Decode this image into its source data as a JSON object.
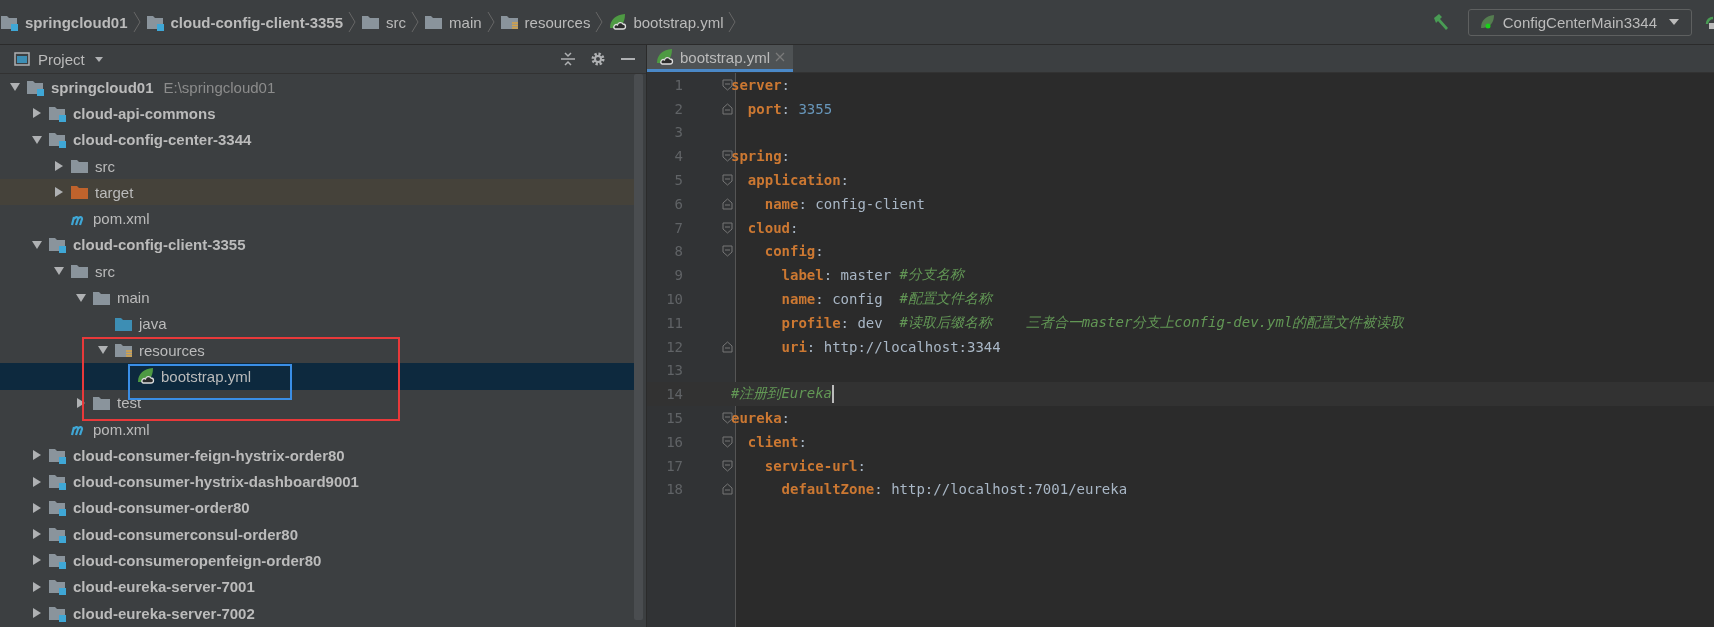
{
  "breadcrumbs": [
    {
      "label": "springcloud01",
      "kind": "module"
    },
    {
      "label": "cloud-config-client-3355",
      "kind": "module"
    },
    {
      "label": "src",
      "kind": "folder"
    },
    {
      "label": "main",
      "kind": "folder"
    },
    {
      "label": "resources",
      "kind": "resources"
    },
    {
      "label": "bootstrap.yml",
      "kind": "yml"
    }
  ],
  "run_config": {
    "label": "ConfigCenterMain3344"
  },
  "project_panel": {
    "title": "Project",
    "tree": [
      {
        "label": "springcloud01",
        "path": "E:\\springcloud01",
        "kind": "module",
        "expanded": true,
        "selected": false,
        "children": [
          {
            "label": "cloud-api-commons",
            "kind": "module",
            "expanded": false,
            "selected": false
          },
          {
            "label": "cloud-config-center-3344",
            "kind": "module",
            "expanded": true,
            "selected": false,
            "children": [
              {
                "label": "src",
                "kind": "folder",
                "expanded": false,
                "selected": false
              },
              {
                "label": "target",
                "kind": "excluded",
                "expanded": false,
                "selected": false
              },
              {
                "label": "pom.xml",
                "kind": "maven",
                "selected": false
              }
            ]
          },
          {
            "label": "cloud-config-client-3355",
            "kind": "module",
            "expanded": true,
            "selected": false,
            "children": [
              {
                "label": "src",
                "kind": "folder",
                "expanded": true,
                "selected": false,
                "children": [
                  {
                    "label": "main",
                    "kind": "folder",
                    "expanded": true,
                    "selected": false,
                    "children": [
                      {
                        "label": "java",
                        "kind": "source",
                        "selected": false
                      },
                      {
                        "label": "resources",
                        "kind": "resources",
                        "expanded": true,
                        "selected": false,
                        "children": [
                          {
                            "label": "bootstrap.yml",
                            "kind": "yml",
                            "selected": true
                          }
                        ]
                      }
                    ]
                  },
                  {
                    "label": "test",
                    "kind": "folder",
                    "expanded": false,
                    "selected": false
                  }
                ]
              },
              {
                "label": "pom.xml",
                "kind": "maven",
                "selected": false
              }
            ]
          },
          {
            "label": "cloud-consumer-feign-hystrix-order80",
            "kind": "module",
            "expanded": false,
            "selected": false
          },
          {
            "label": "cloud-consumer-hystrix-dashboard9001",
            "kind": "module",
            "expanded": false,
            "selected": false
          },
          {
            "label": "cloud-consumer-order80",
            "kind": "module",
            "expanded": false,
            "selected": false
          },
          {
            "label": "cloud-consumerconsul-order80",
            "kind": "module",
            "expanded": false,
            "selected": false
          },
          {
            "label": "cloud-consumeropenfeign-order80",
            "kind": "module",
            "expanded": false,
            "selected": false
          },
          {
            "label": "cloud-eureka-server-7001",
            "kind": "module",
            "expanded": false,
            "selected": false
          },
          {
            "label": "cloud-eureka-server-7002",
            "kind": "module",
            "expanded": false,
            "selected": false
          }
        ]
      }
    ]
  },
  "annotations": [
    {
      "kind": "frame",
      "color": "#e8393a"
    },
    {
      "kind": "frame",
      "color": "#3a8ee6"
    }
  ],
  "editor": {
    "tabs": [
      {
        "label": "bootstrap.yml",
        "selected": true
      }
    ],
    "lines": [
      {
        "number": "1",
        "fold_open": true,
        "fold_close": false,
        "current": false,
        "tokens": [
          {
            "text": "server",
            "kind": "key"
          },
          {
            "text": ":",
            "kind": "plain"
          }
        ]
      },
      {
        "number": "2",
        "fold_open": false,
        "fold_close": true,
        "current": false,
        "tokens": [
          {
            "text": "  port",
            "kind": "key"
          },
          {
            "text": ": ",
            "kind": "plain"
          },
          {
            "text": "3355",
            "kind": "number"
          }
        ]
      },
      {
        "number": "3",
        "fold_open": false,
        "fold_close": false,
        "current": false
      },
      {
        "number": "4",
        "fold_open": true,
        "fold_close": false,
        "current": false,
        "tokens": [
          {
            "text": "spring",
            "kind": "key"
          },
          {
            "text": ":",
            "kind": "plain"
          }
        ]
      },
      {
        "number": "5",
        "fold_open": true,
        "fold_close": false,
        "current": false,
        "tokens": [
          {
            "text": "  application",
            "kind": "key"
          },
          {
            "text": ":",
            "kind": "plain"
          }
        ]
      },
      {
        "number": "6",
        "fold_open": false,
        "fold_close": true,
        "current": false,
        "tokens": [
          {
            "text": "    name",
            "kind": "key"
          },
          {
            "text": ": config-client",
            "kind": "plain"
          }
        ]
      },
      {
        "number": "7",
        "fold_open": true,
        "fold_close": false,
        "current": false,
        "tokens": [
          {
            "text": "  cloud",
            "kind": "key"
          },
          {
            "text": ":",
            "kind": "plain"
          }
        ]
      },
      {
        "number": "8",
        "fold_open": true,
        "fold_close": false,
        "current": false,
        "tokens": [
          {
            "text": "    config",
            "kind": "key"
          },
          {
            "text": ":",
            "kind": "plain"
          }
        ]
      },
      {
        "number": "9",
        "fold_open": false,
        "fold_close": false,
        "current": false,
        "tokens": [
          {
            "text": "      label",
            "kind": "key"
          },
          {
            "text": ": master ",
            "kind": "plain"
          },
          {
            "text": "#分支名称",
            "kind": "comment"
          }
        ]
      },
      {
        "number": "10",
        "fold_open": false,
        "fold_close": false,
        "current": false,
        "tokens": [
          {
            "text": "      name",
            "kind": "key"
          },
          {
            "text": ": config  ",
            "kind": "plain"
          },
          {
            "text": "#配置文件名称",
            "kind": "comment"
          }
        ]
      },
      {
        "number": "11",
        "fold_open": false,
        "fold_close": false,
        "current": false,
        "tokens": [
          {
            "text": "      profile",
            "kind": "key"
          },
          {
            "text": ": dev  ",
            "kind": "plain"
          },
          {
            "text": "#读取后缀名称    三者合一master分支上config-dev.yml的配置文件被读取",
            "kind": "comment"
          }
        ]
      },
      {
        "number": "12",
        "fold_open": false,
        "fold_close": true,
        "current": false,
        "tokens": [
          {
            "text": "      uri",
            "kind": "key"
          },
          {
            "text": ": http://localhost:3344",
            "kind": "plain"
          }
        ]
      },
      {
        "number": "13",
        "fold_open": false,
        "fold_close": false,
        "current": false
      },
      {
        "number": "14",
        "fold_open": false,
        "fold_close": false,
        "current": true,
        "tokens": [
          {
            "text": "#注册到Eureka",
            "kind": "comment"
          }
        ]
      },
      {
        "number": "15",
        "fold_open": true,
        "fold_close": false,
        "current": false,
        "tokens": [
          {
            "text": "eureka",
            "kind": "key"
          },
          {
            "text": ":",
            "kind": "plain"
          }
        ]
      },
      {
        "number": "16",
        "fold_open": true,
        "fold_close": false,
        "current": false,
        "tokens": [
          {
            "text": "  client",
            "kind": "key"
          },
          {
            "text": ":",
            "kind": "plain"
          }
        ]
      },
      {
        "number": "17",
        "fold_open": true,
        "fold_close": false,
        "current": false,
        "tokens": [
          {
            "text": "    service-url",
            "kind": "key"
          },
          {
            "text": ":",
            "kind": "plain"
          }
        ]
      },
      {
        "number": "18",
        "fold_open": false,
        "fold_close": true,
        "current": false,
        "tokens": [
          {
            "text": "      defaultZone",
            "kind": "key"
          },
          {
            "text": ": http://localhost:7001/eureka",
            "kind": "plain"
          }
        ]
      }
    ]
  }
}
